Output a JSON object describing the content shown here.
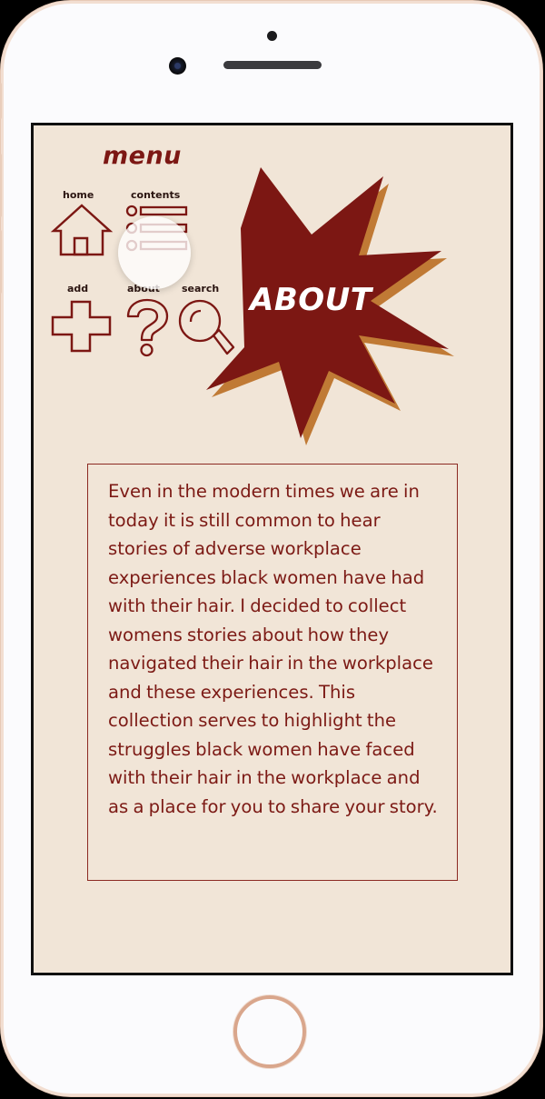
{
  "menu": {
    "title": "menu",
    "items": [
      {
        "label": "home",
        "icon": "home-icon"
      },
      {
        "label": "contents",
        "icon": "list-icon"
      },
      {
        "label": "add",
        "icon": "plus-icon"
      },
      {
        "label": "about",
        "icon": "question-mark-icon"
      },
      {
        "label": "search",
        "icon": "search-icon"
      }
    ]
  },
  "page": {
    "heading": "ABOUT",
    "body": "Even in the modern times we are in today it is still common to hear stories of adverse workplace experiences black women have had with their hair. I decided to collect womens stories about  how they navigated their hair in the workplace and these experiences. This collection serves to highlight the struggles black women have faced with their hair in the workplace and as a place for you to share your story."
  },
  "colors": {
    "background": "#f1e5d7",
    "accent": "#7c1713",
    "shadow": "#c07a35",
    "text": "#7c1a15",
    "device_frame": "#fbfbfd"
  }
}
